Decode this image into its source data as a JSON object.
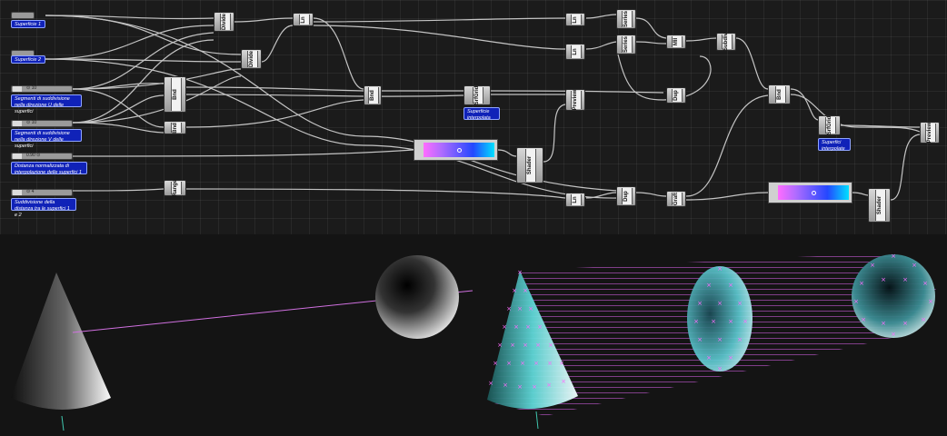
{
  "inputs": {
    "surface1": "Superficie 1",
    "surface2": "Superficie 2"
  },
  "sliders": [
    {
      "value": "⊙ 10",
      "label": "Segmenti di suddivisione nella direzione U delle superfici"
    },
    {
      "value": "⊙ 10",
      "label": "Segmenti di suddivisione nella direzione V delle superfici"
    },
    {
      "value": "0.90 ⊙",
      "label": "Distanza normalizzata di interpolazione delle superfici 1"
    },
    {
      "value": "⊙ 4",
      "label": "Suddivisione della distanza tra le superfici 1 e 2"
    }
  ],
  "outputs": {
    "interp_surface": "Superficie interpolata",
    "interp_surfaces": "Superfici interpolate"
  },
  "components": [
    "Divide",
    "Divide",
    "Ln",
    "Bnd",
    "SrfGrid",
    "Preview",
    "Shader",
    "Bnd",
    "Ln",
    "Ln",
    "Series",
    "Series",
    "Ln",
    "Mll",
    "Subdiv",
    "Bnd",
    "SrfGrid",
    "Preview",
    "Shader",
    "Range",
    "Bnd",
    "Dup",
    "Graft",
    "Ln",
    "Dup",
    "Series"
  ],
  "colors": {
    "canvas": "#1b1b1b",
    "wire": "#c8c8c8",
    "panel": "#1022b8",
    "viewport": "#141414",
    "line_magenta": "#d070e0",
    "cyan_solid": "#5ad0d0"
  },
  "scene": {
    "left": [
      "cone",
      "sphere"
    ],
    "right": [
      "cone",
      "ellipsoid",
      "sphere"
    ],
    "point_marker": "×"
  }
}
